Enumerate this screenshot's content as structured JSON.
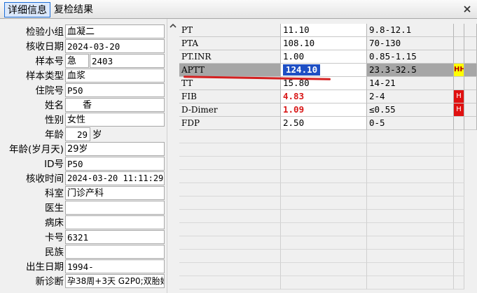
{
  "tabs": [
    {
      "label": "详细信息"
    },
    {
      "label": "复检结果"
    }
  ],
  "form": {
    "group_label": "检验小组",
    "group_value": "血凝二",
    "receive_date_label": "核收日期",
    "receive_date_value": "2024-03-20",
    "sample_no_label": "样本号",
    "sample_no_urgent": "急",
    "sample_no_value": "2403",
    "sample_type_label": "样本类型",
    "sample_type_value": "血浆",
    "inpatient_no_label": "住院号",
    "inpatient_no_value": "P50",
    "name_label": "姓名",
    "name_value": "香",
    "gender_label": "性别",
    "gender_value": "女性",
    "age_label": "年龄",
    "age_value": "29",
    "age_unit": "岁",
    "age_ymd_label": "年龄(岁月天)",
    "age_ymd_value": "29岁",
    "id_label": "ID号",
    "id_value": "P50",
    "receive_time_label": "核收时间",
    "receive_time_value": "2024-03-20 11:11:29",
    "department_label": "科室",
    "department_value": "门诊产科",
    "doctor_label": "医生",
    "doctor_value": "",
    "bed_label": "病床",
    "bed_value": "",
    "card_label": "卡号",
    "card_value": "6321",
    "ethnicity_label": "民族",
    "ethnicity_value": "",
    "birth_date_label": "出生日期",
    "birth_date_value": "1994-",
    "diagnosis_label": "新诊断",
    "diagnosis_value": "孕38周+3天 G2P0;双胎妊"
  },
  "results": [
    {
      "name": "PT",
      "result": "11.10",
      "range": "9.8-12.1",
      "flag": ""
    },
    {
      "name": "PTA",
      "result": "108.10",
      "range": "70-130",
      "flag": ""
    },
    {
      "name": "PT.INR",
      "result": "1.00",
      "range": "0.85-1.15",
      "flag": ""
    },
    {
      "name": "APTT",
      "result": "124.10",
      "range": "23.3-32.5",
      "flag": "HH"
    },
    {
      "name": "TT",
      "result": "15.80",
      "range": "14-21",
      "flag": ""
    },
    {
      "name": "FIB",
      "result": "4.83",
      "range": "2-4",
      "flag": "H"
    },
    {
      "name": "D-Dimer",
      "result": "1.09",
      "range": "≤0.55",
      "flag": "H"
    },
    {
      "name": "FDP",
      "result": "2.50",
      "range": "0-5",
      "flag": ""
    }
  ],
  "colors": {
    "high": "#d81818",
    "flag_h_bg": "#e01010",
    "flag_hh_bg": "#ffff00",
    "selection": "#1e4fc4"
  },
  "icons": [
    "close-icon",
    "scroll-up-icon"
  ]
}
